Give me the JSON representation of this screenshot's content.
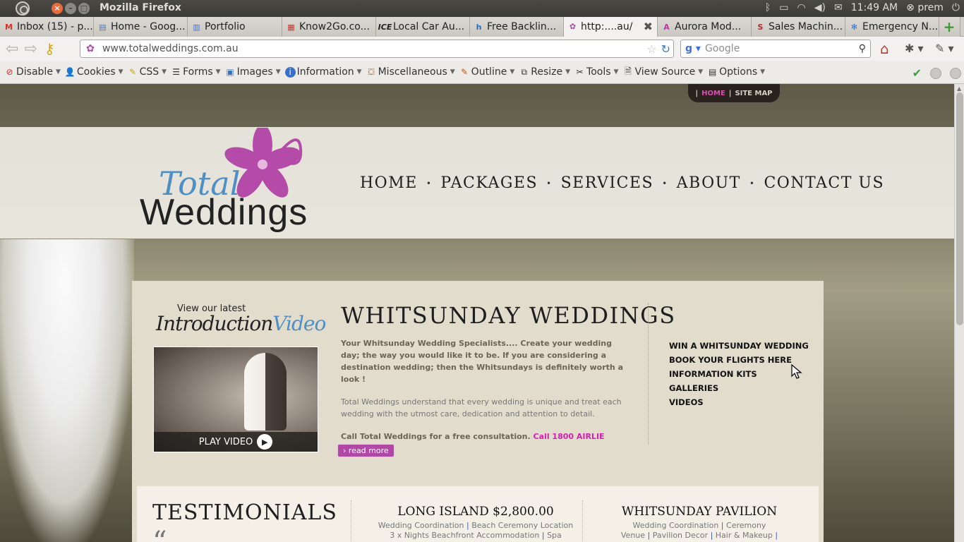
{
  "panel": {
    "window_title": "Mozilla Firefox",
    "time": "11:49 AM",
    "user": "prem"
  },
  "tabs": [
    {
      "label": "Inbox (15) - p...",
      "icon": "gmail-icon",
      "color": "#d93025"
    },
    {
      "label": "Home - Goog...",
      "icon": "google-sites-icon",
      "color": "#4a76c9"
    },
    {
      "label": "Portfolio",
      "icon": "page-icon",
      "color": "#4a76c9"
    },
    {
      "label": "Know2Go.co...",
      "icon": "know2go-icon",
      "color": "#c0392b"
    },
    {
      "label": "Local Car Au...",
      "icon": "ice-icon",
      "color": "#222222"
    },
    {
      "label": "Free Backlin...",
      "icon": "backlink-icon",
      "color": "#2d6cb5"
    },
    {
      "label": "http:....au/",
      "icon": "totalweddings-icon",
      "color": "#b544b2",
      "active": true
    },
    {
      "label": "Aurora Mod...",
      "icon": "aurora-icon",
      "color": "#c92fa9"
    },
    {
      "label": "Sales Machin...",
      "icon": "sales-icon",
      "color": "#b52a2a"
    },
    {
      "label": "Emergency N...",
      "icon": "emergency-icon",
      "color": "#3a6fc9"
    }
  ],
  "navbar": {
    "url": "www.totalweddings.com.au",
    "search_placeholder": "Google"
  },
  "devtoolbar": [
    {
      "label": "Disable",
      "icon": "disable-icon"
    },
    {
      "label": "Cookies",
      "icon": "cookies-icon"
    },
    {
      "label": "CSS",
      "icon": "css-icon"
    },
    {
      "label": "Forms",
      "icon": "forms-icon"
    },
    {
      "label": "Images",
      "icon": "images-icon"
    },
    {
      "label": "Information",
      "icon": "information-icon"
    },
    {
      "label": "Miscellaneous",
      "icon": "miscellaneous-icon"
    },
    {
      "label": "Outline",
      "icon": "outline-icon"
    },
    {
      "label": "Resize",
      "icon": "resize-icon"
    },
    {
      "label": "Tools",
      "icon": "tools-icon"
    },
    {
      "label": "View Source",
      "icon": "view-source-icon"
    },
    {
      "label": "Options",
      "icon": "options-icon"
    }
  ],
  "site": {
    "topnav": {
      "home": "HOME",
      "sitemap": "SITE MAP"
    },
    "logo": {
      "line1": "Total",
      "line2": "Weddings"
    },
    "mainnav": [
      "HOME",
      "PACKAGES",
      "SERVICES",
      "ABOUT",
      "CONTACT US"
    ],
    "video": {
      "label": "View our latest",
      "script_a": "Introduction",
      "script_b": "Video",
      "play": "PLAY VIDEO"
    },
    "title": "WHITSUNDAY WEDDINGS",
    "intro": "Your Whitsunday Wedding Specialists.... Create your wedding day; the way you would like it to be. If you are considering a destination wedding; then the Whitsundays is definitely worth a look !",
    "intro2": "Total Weddings understand that every wedding is unique and treat each wedding with the utmost care, dedication and attention to detail.",
    "call_text": "Call Total Weddings for a free consultation.",
    "call_number": "Call 1800 AIRLIE",
    "readmore": "› read more",
    "quicklinks": [
      "WIN A WHITSUNDAY WEDDING",
      "BOOK YOUR FLIGHTS HERE",
      "INFORMATION KITS",
      "GALLERIES",
      "VIDEOS"
    ],
    "testimonials": "TESTIMONIALS",
    "quote_mark": "“",
    "packages": [
      {
        "title": "LONG ISLAND $2,800.00",
        "line1": [
          "Wedding Coordination",
          "Beach Ceremony Location"
        ],
        "line2": [
          "3 x Nights Beachfront Accommodation",
          "Spa"
        ]
      },
      {
        "title": "WHITSUNDAY PAVILION",
        "line1": [
          "Wedding Coordination",
          "Ceremony"
        ],
        "line2": [
          "Venue",
          "Pavilion Decor",
          "Hair & Makeup",
          ""
        ]
      }
    ]
  }
}
